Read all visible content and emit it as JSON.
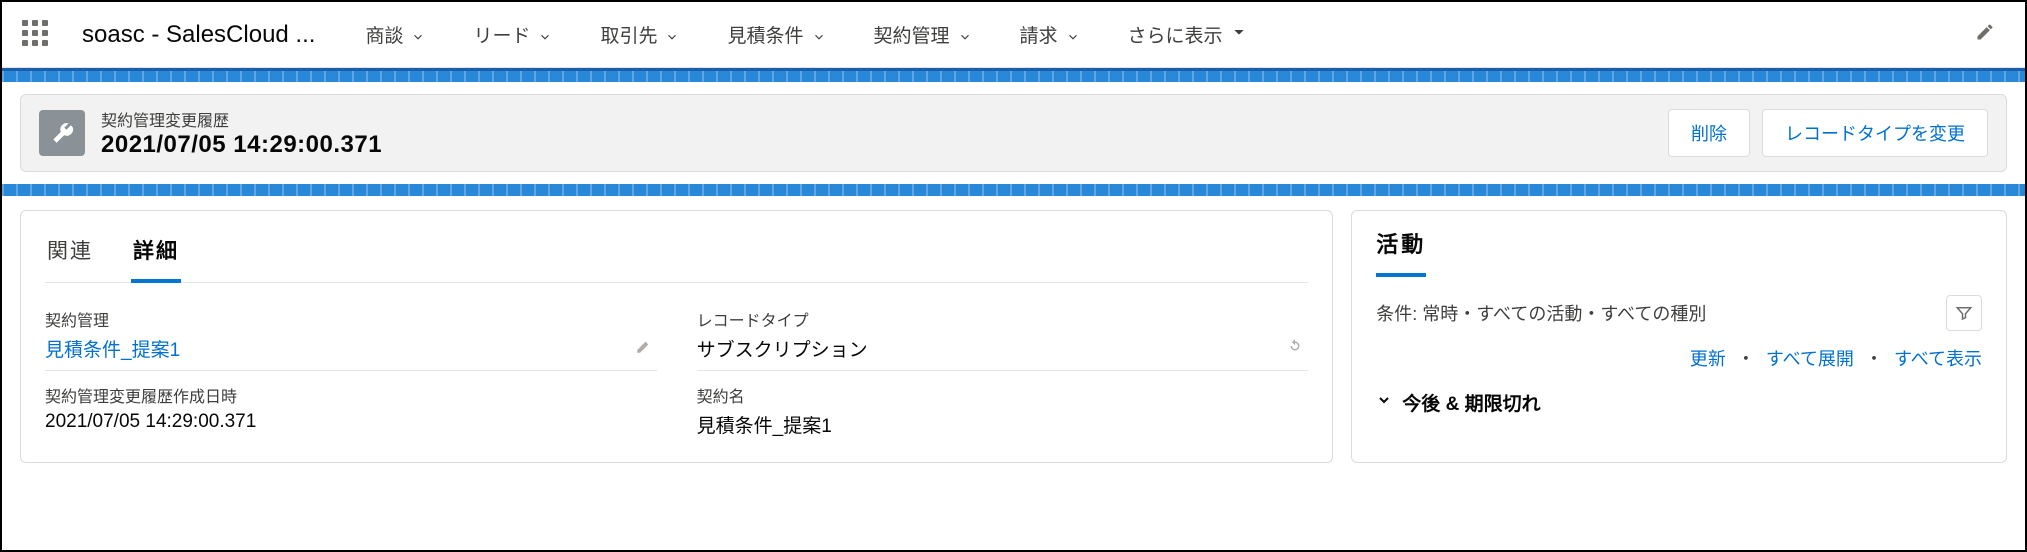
{
  "header": {
    "app_name": "soasc - SalesCloud ...",
    "nav": [
      "商談",
      "リード",
      "取引先",
      "見積条件",
      "契約管理",
      "請求"
    ],
    "more_label": "さらに表示"
  },
  "record": {
    "object_label": "契約管理変更履歴",
    "title": "2021/07/05 14:29:00.371",
    "actions": {
      "delete": "削除",
      "change_type": "レコードタイプを変更"
    }
  },
  "tabs": {
    "related": "関連",
    "detail": "詳細"
  },
  "fields": {
    "contract_mgmt": {
      "label": "契約管理",
      "value": "見積条件_提案1"
    },
    "record_type": {
      "label": "レコードタイプ",
      "value": "サブスクリプション"
    },
    "created_at": {
      "label": "契約管理変更履歴作成日時",
      "value": "2021/07/05 14:29:00.371"
    },
    "contract_name": {
      "label": "契約名",
      "value": "見積条件_提案1"
    }
  },
  "activity": {
    "title": "活動",
    "filter_text": "条件: 常時・すべての活動・すべての種別",
    "links": {
      "refresh": "更新",
      "expand_all": "すべて展開",
      "show_all": "すべて表示"
    },
    "section": "今後 & 期限切れ"
  }
}
